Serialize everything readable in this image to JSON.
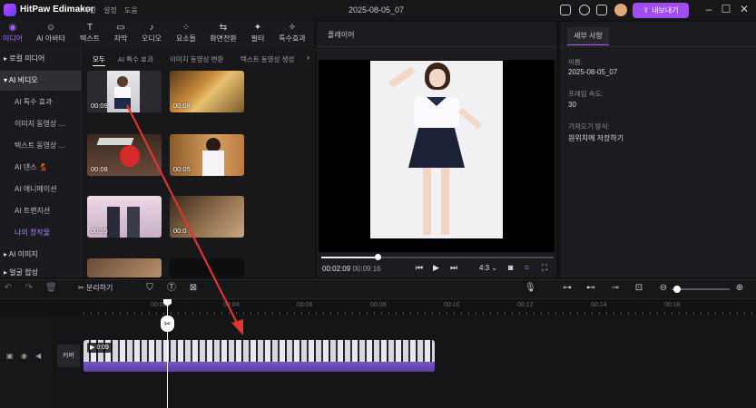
{
  "app": {
    "name": "HitPaw Edimakor",
    "menus": [
      "파일",
      "설정",
      "도움"
    ],
    "doc_title": "2025-08-05_07",
    "export_label": "내보내기",
    "accent_color": "#a04cf0"
  },
  "tool_tabs": [
    {
      "label": "미디어",
      "icon": "media-icon"
    },
    {
      "label": "AI 아바타",
      "icon": "avatar-icon"
    },
    {
      "label": "텍스트",
      "icon": "text-icon"
    },
    {
      "label": "자막",
      "icon": "subtitle-icon"
    },
    {
      "label": "오디오",
      "icon": "audio-icon"
    },
    {
      "label": "요소들",
      "icon": "elements-icon"
    },
    {
      "label": "화면전환",
      "icon": "transition-icon"
    },
    {
      "label": "필터",
      "icon": "filter-icon"
    },
    {
      "label": "특수효과",
      "icon": "effects-icon"
    }
  ],
  "categories": [
    {
      "label": "로컬 미디어"
    },
    {
      "label": "AI 비디오"
    },
    {
      "label": "AI 특수 효과"
    },
    {
      "label": "이미지 동영상 ..."
    },
    {
      "label": "텍스트 동영상 ..."
    },
    {
      "label": "AI 댄스 💃"
    },
    {
      "label": "AI 애니메이션"
    },
    {
      "label": "AI 트랜지션"
    },
    {
      "label": "나의 창작물"
    },
    {
      "label": "AI 이미지"
    },
    {
      "label": "얼굴 합성"
    }
  ],
  "sub_tabs": [
    "모두",
    "AI 특수 효과",
    "이미지 동영상 변환",
    "텍스트 동영상 생성"
  ],
  "thumbnails": [
    {
      "duration": "00:09"
    },
    {
      "duration": "00:08"
    },
    {
      "duration": "00:08"
    },
    {
      "duration": "00:05"
    },
    {
      "duration": "00:05"
    },
    {
      "duration": "00:0"
    }
  ],
  "player": {
    "title": "플레이어",
    "time_current": "00:02:09",
    "time_total": "/ 00:09:16",
    "aspect": "4:3",
    "progress_fraction": 0.24
  },
  "details": {
    "tab_label": "세부 사항",
    "name_label": "이름:",
    "name_value": "2025-08-05_07",
    "fps_label": "프레임 속도:",
    "fps_value": "30",
    "import_label": "가져오기 방식:",
    "import_value": "원위치에 저장하기"
  },
  "timeline": {
    "split_label": "분리하기",
    "ruler_ticks": [
      "00:02",
      "00:04",
      "00:06",
      "00:08",
      "00:10",
      "00:12",
      "00:14",
      "00:16"
    ],
    "cover_label": "커버",
    "clip_duration": "0:09"
  }
}
